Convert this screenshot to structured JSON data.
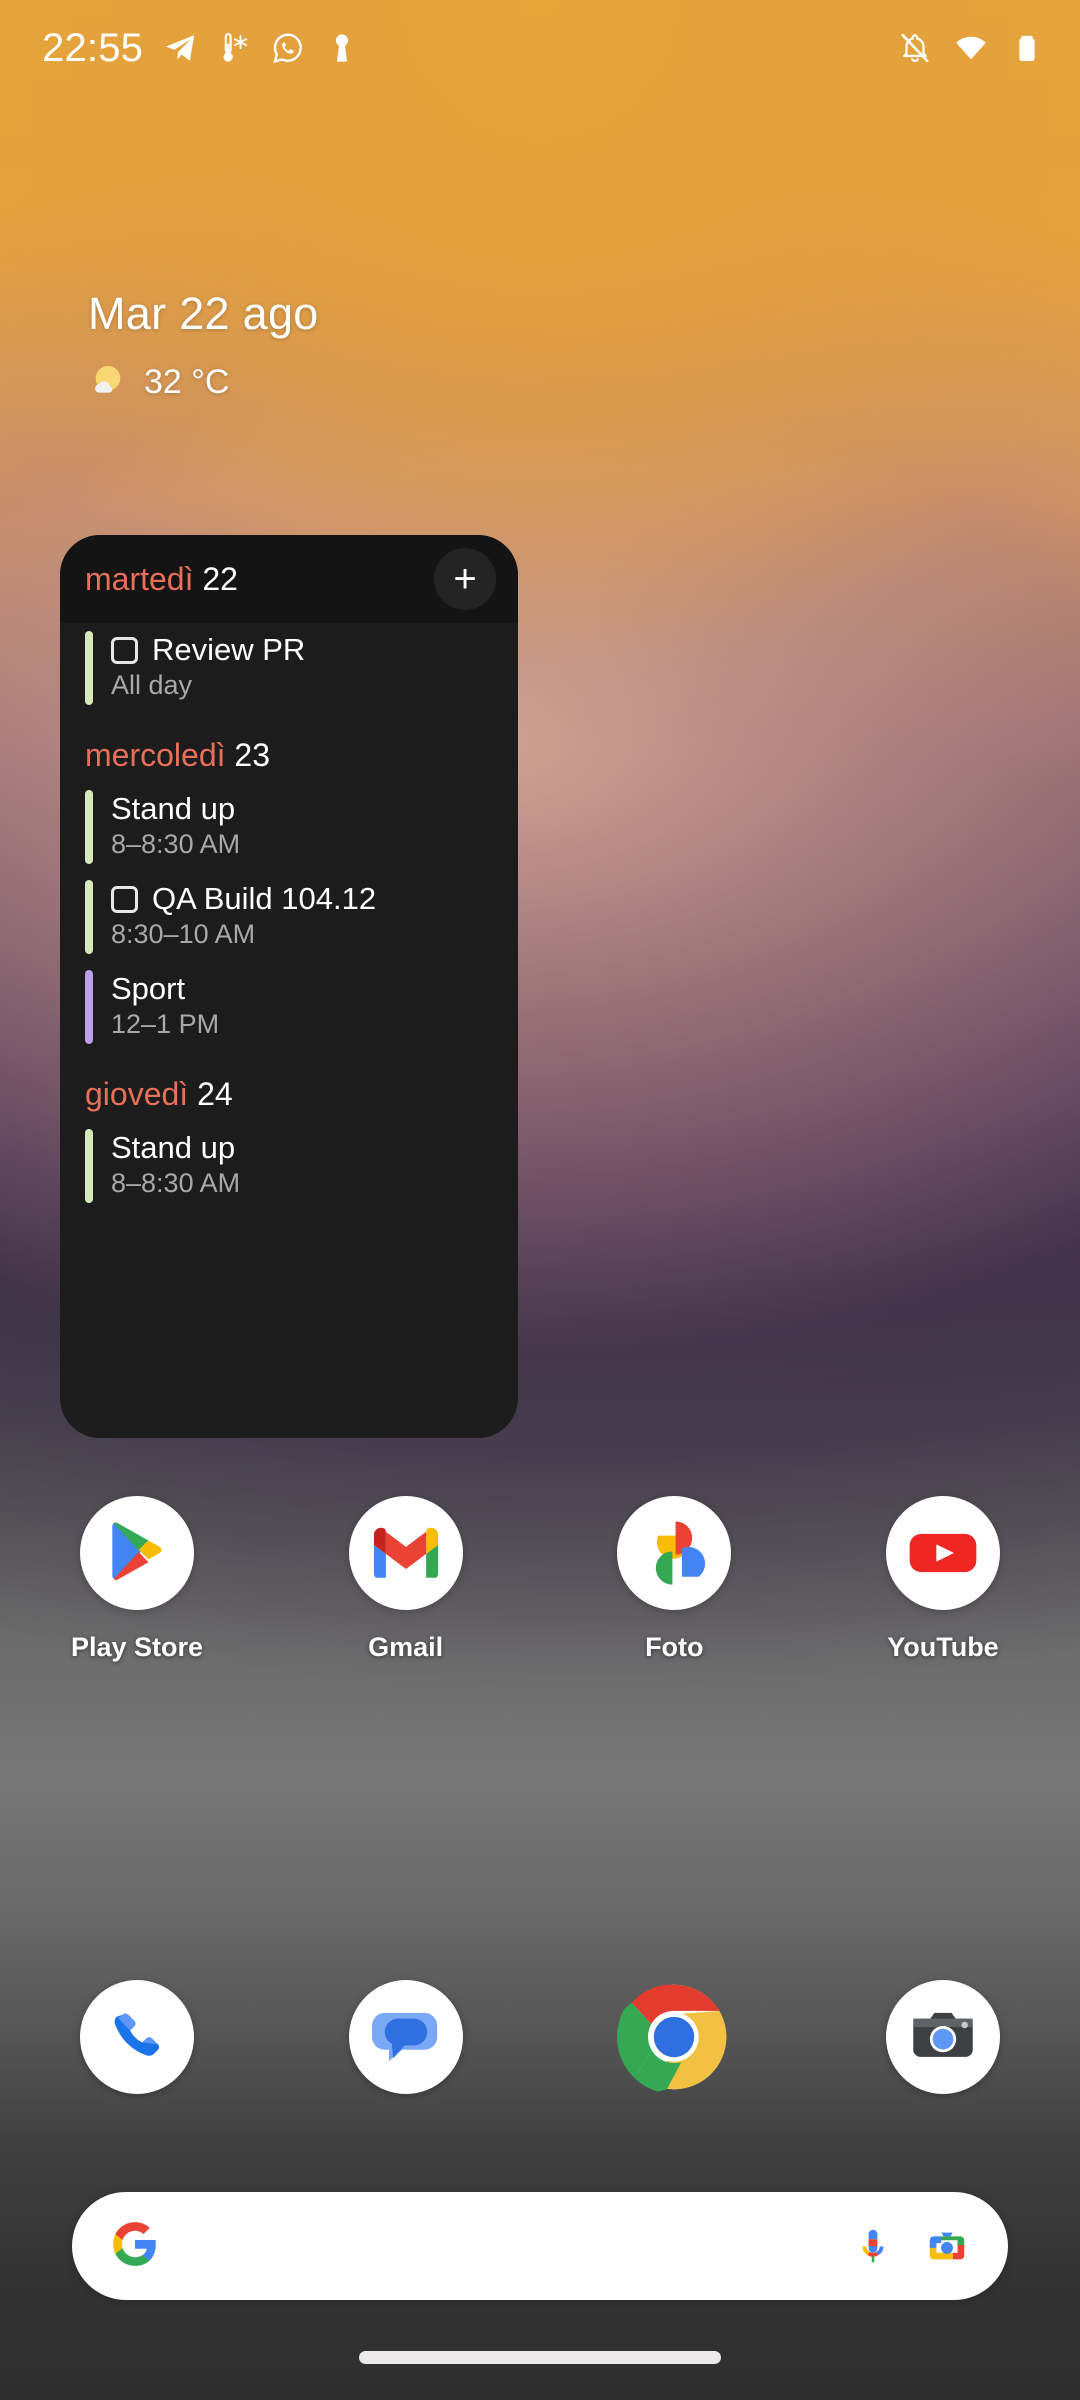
{
  "status_bar": {
    "time": "22:55",
    "left_icons": [
      {
        "name": "telegram-icon"
      },
      {
        "name": "thermometer-weather-icon"
      },
      {
        "name": "whatsapp-icon"
      },
      {
        "name": "key-icon"
      }
    ],
    "right_icons": [
      {
        "name": "notifications-silenced-icon"
      },
      {
        "name": "wifi-icon"
      },
      {
        "name": "battery-icon"
      }
    ]
  },
  "date_weather": {
    "date": "Mar 22 ago",
    "weather_icon": "sun-cloud-icon",
    "temperature": "32 °C"
  },
  "calendar_widget": {
    "header": {
      "day_name": "martedì",
      "day_number": "22",
      "add_label": "+"
    },
    "sections": [
      {
        "day_name": "",
        "day_number": "",
        "events": [
          {
            "title": "Review PR",
            "time": "All day",
            "color": "#d5e8b8",
            "has_checkbox": true
          }
        ]
      },
      {
        "day_name": "mercoledì",
        "day_number": "23",
        "events": [
          {
            "title": "Stand up",
            "time": "8–8:30 AM",
            "color": "#d5e8b8",
            "has_checkbox": false
          },
          {
            "title": "QA Build 104.12",
            "time": "8:30–10 AM",
            "color": "#d5e8b8",
            "has_checkbox": true
          },
          {
            "title": "Sport",
            "time": "12–1 PM",
            "color": "#b9a0e8",
            "has_checkbox": false
          }
        ]
      },
      {
        "day_name": "giovedì",
        "day_number": "24",
        "events": [
          {
            "title": "Stand up",
            "time": "8–8:30 AM",
            "color": "#d5e8b8",
            "has_checkbox": false
          }
        ]
      }
    ]
  },
  "app_grid": [
    {
      "label": "Play Store",
      "icon": "play-store-icon"
    },
    {
      "label": "Gmail",
      "icon": "gmail-icon"
    },
    {
      "label": "Foto",
      "icon": "google-photos-icon"
    },
    {
      "label": "YouTube",
      "icon": "youtube-icon"
    }
  ],
  "dock": [
    {
      "label": "Phone",
      "icon": "phone-icon"
    },
    {
      "label": "Messages",
      "icon": "messages-icon"
    },
    {
      "label": "Chrome",
      "icon": "chrome-icon"
    },
    {
      "label": "Camera",
      "icon": "camera-icon"
    }
  ],
  "search_bar": {
    "query": "",
    "placeholder": "",
    "logo_icon": "google-g-icon",
    "mic_icon": "microphone-icon",
    "lens_icon": "google-lens-icon"
  },
  "nav": {
    "pill": "home-gesture-pill"
  },
  "colors": {
    "widget_bg": "#1c1c1c",
    "widget_header_bg": "#141414",
    "day_accent": "#e8705a",
    "event_green": "#d5e8b8",
    "event_purple": "#b9a0e8",
    "secondary_text": "#a8a8a8"
  }
}
